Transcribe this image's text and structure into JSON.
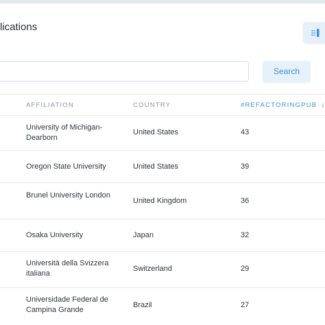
{
  "page": {
    "title_fragment": "lications"
  },
  "search": {
    "placeholder": "",
    "value": "",
    "button_label": "Search"
  },
  "table": {
    "columns": [
      {
        "label": "AFFILIATION"
      },
      {
        "label": "COUNTRY"
      },
      {
        "label": "#REFACTORINGPUB",
        "sort": "desc",
        "sort_arrow": "↓"
      }
    ],
    "rows": [
      {
        "affiliation": "University of Michigan-Dearborn",
        "country": "United States",
        "count": "43"
      },
      {
        "affiliation": "Oregon State University",
        "country": "United States",
        "count": "39"
      },
      {
        "affiliation": "Brunel University London",
        "country": "United Kingdom",
        "count": "36"
      },
      {
        "affiliation": "Osaka University",
        "country": "Japan",
        "count": "32"
      },
      {
        "affiliation": "Università della Svizzera italiana",
        "country": "Switzerland",
        "count": "29"
      },
      {
        "affiliation": "Universidade Federal de Campina Grande",
        "country": "Brazil",
        "count": "27"
      }
    ]
  },
  "colors": {
    "accent": "#3f8fd9",
    "button_bg": "#e7f1fb"
  },
  "icons": {
    "top_right_button": "column-settings-icon"
  }
}
